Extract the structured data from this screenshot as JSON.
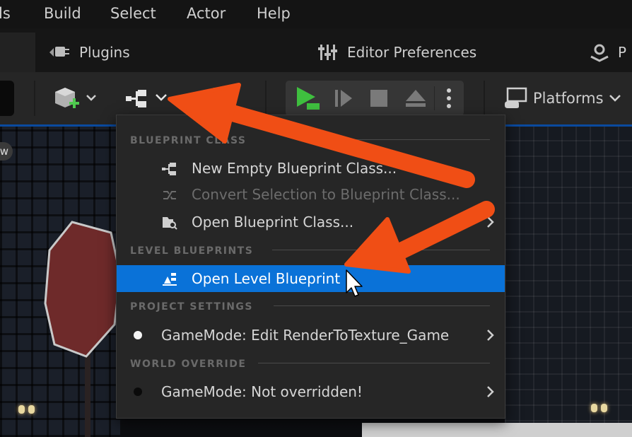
{
  "menubar": {
    "items": [
      "ls",
      "Build",
      "Select",
      "Actor",
      "Help"
    ]
  },
  "tabs": {
    "items": [
      {
        "label": "Plugins",
        "icon": "plug-icon"
      },
      {
        "label": "Editor Preferences",
        "icon": "sliders-icon"
      },
      {
        "label": "P",
        "icon": "project-settings-icon"
      }
    ]
  },
  "toolbar": {
    "icons": [
      "add-actor-icon",
      "blueprint-icon",
      "cinematics-icon",
      "play-icon",
      "step-icon",
      "stop-icon",
      "eject-icon",
      "more-vertical-icon"
    ],
    "platforms_label": "Platforms"
  },
  "viewport": {
    "bubble_text": "w"
  },
  "dropdown": {
    "sections": {
      "blueprint_class": "BLUEPRINT CLASS",
      "level_blueprints": "LEVEL BLUEPRINTS",
      "project_settings": "PROJECT SETTINGS",
      "world_override": "WORLD OVERRIDE"
    },
    "items": {
      "new_empty": "New Empty Blueprint Class...",
      "convert_selection": "Convert Selection to Blueprint Class...",
      "open_class": "Open Blueprint Class...",
      "open_level": "Open Level Blueprint",
      "gamemode_edit": "GameMode: Edit RenderToTexture_Game",
      "gamemode_override": "GameMode: Not overridden!"
    }
  },
  "colors": {
    "highlight": "#0a72d8",
    "annotation_arrow": "#f04e15",
    "play_green": "#3fbf3f",
    "toolbar_accent": "#0a4a9f"
  }
}
